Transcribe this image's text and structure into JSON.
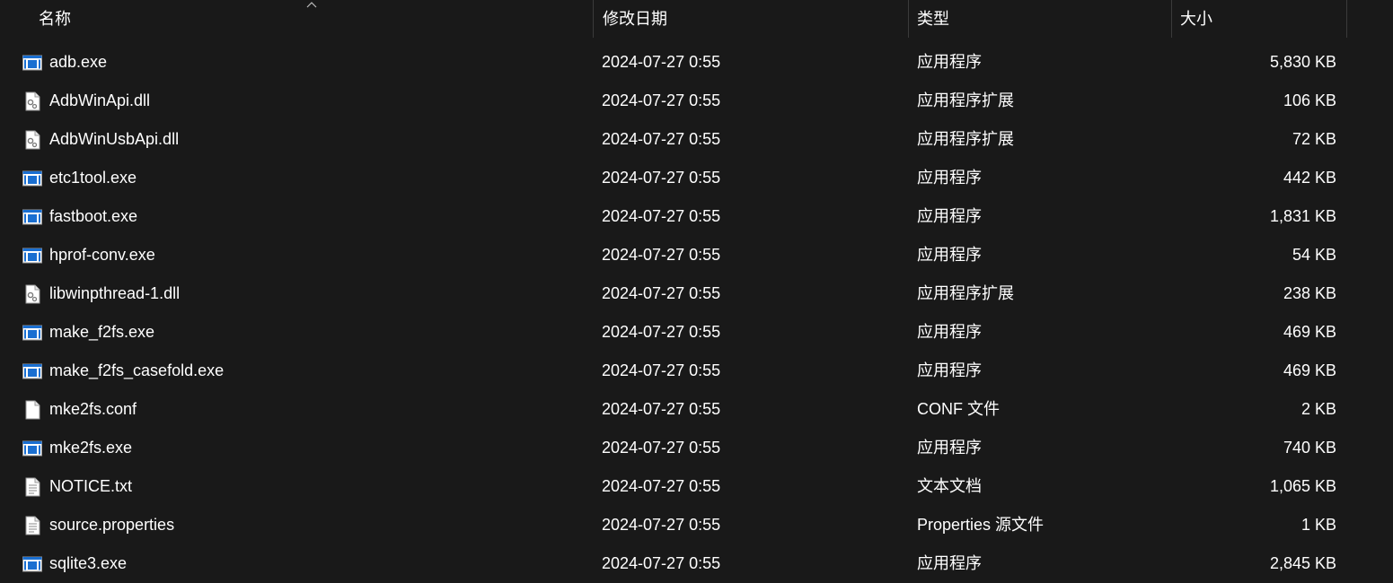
{
  "columns": {
    "name": "名称",
    "modified": "修改日期",
    "type": "类型",
    "size": "大小"
  },
  "sort": {
    "column": "name",
    "direction": "ascending"
  },
  "files": [
    {
      "name": "adb.exe",
      "modified": "2024-07-27 0:55",
      "type": "应用程序",
      "size": "5,830 KB",
      "icon": "exe-icon"
    },
    {
      "name": "AdbWinApi.dll",
      "modified": "2024-07-27 0:55",
      "type": "应用程序扩展",
      "size": "106 KB",
      "icon": "dll-icon"
    },
    {
      "name": "AdbWinUsbApi.dll",
      "modified": "2024-07-27 0:55",
      "type": "应用程序扩展",
      "size": "72 KB",
      "icon": "dll-icon"
    },
    {
      "name": "etc1tool.exe",
      "modified": "2024-07-27 0:55",
      "type": "应用程序",
      "size": "442 KB",
      "icon": "exe-icon"
    },
    {
      "name": "fastboot.exe",
      "modified": "2024-07-27 0:55",
      "type": "应用程序",
      "size": "1,831 KB",
      "icon": "exe-icon"
    },
    {
      "name": "hprof-conv.exe",
      "modified": "2024-07-27 0:55",
      "type": "应用程序",
      "size": "54 KB",
      "icon": "exe-icon"
    },
    {
      "name": "libwinpthread-1.dll",
      "modified": "2024-07-27 0:55",
      "type": "应用程序扩展",
      "size": "238 KB",
      "icon": "dll-icon"
    },
    {
      "name": "make_f2fs.exe",
      "modified": "2024-07-27 0:55",
      "type": "应用程序",
      "size": "469 KB",
      "icon": "exe-icon"
    },
    {
      "name": "make_f2fs_casefold.exe",
      "modified": "2024-07-27 0:55",
      "type": "应用程序",
      "size": "469 KB",
      "icon": "exe-icon"
    },
    {
      "name": "mke2fs.conf",
      "modified": "2024-07-27 0:55",
      "type": "CONF 文件",
      "size": "2 KB",
      "icon": "blank-file-icon"
    },
    {
      "name": "mke2fs.exe",
      "modified": "2024-07-27 0:55",
      "type": "应用程序",
      "size": "740 KB",
      "icon": "exe-icon"
    },
    {
      "name": "NOTICE.txt",
      "modified": "2024-07-27 0:55",
      "type": "文本文档",
      "size": "1,065 KB",
      "icon": "text-file-icon"
    },
    {
      "name": "source.properties",
      "modified": "2024-07-27 0:55",
      "type": "Properties 源文件",
      "size": "1 KB",
      "icon": "text-file-icon"
    },
    {
      "name": "sqlite3.exe",
      "modified": "2024-07-27 0:55",
      "type": "应用程序",
      "size": "2,845 KB",
      "icon": "exe-icon"
    }
  ],
  "colors": {
    "background": "#191919",
    "text": "#ffffff",
    "exe_accent": "#1a6fd1",
    "divider": "#3a3a3a"
  }
}
